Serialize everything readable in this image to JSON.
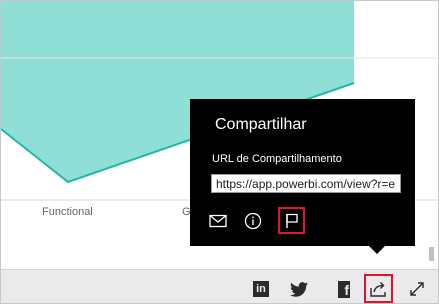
{
  "chart": {
    "categories": [
      "Functional",
      "G"
    ],
    "fill_color": "#8fdfd6",
    "line_color": "#1fb8a8"
  },
  "share_popup": {
    "title": "Compartilhar",
    "url_label": "URL de Compartilhamento",
    "url_value": "https://app.powerbi.com/view?r=e",
    "icons": [
      "mail-icon",
      "info-icon",
      "flag-icon"
    ]
  },
  "bottom_bar": {
    "icons": [
      "linkedin-icon",
      "twitter-icon",
      "facebook-icon",
      "share-icon",
      "fullscreen-icon"
    ],
    "linkedin_text": "in",
    "facebook_text": "f"
  },
  "colors": {
    "highlight": "#e8112d",
    "popup_bg": "#000000",
    "bar_bg": "#eaeaea"
  }
}
